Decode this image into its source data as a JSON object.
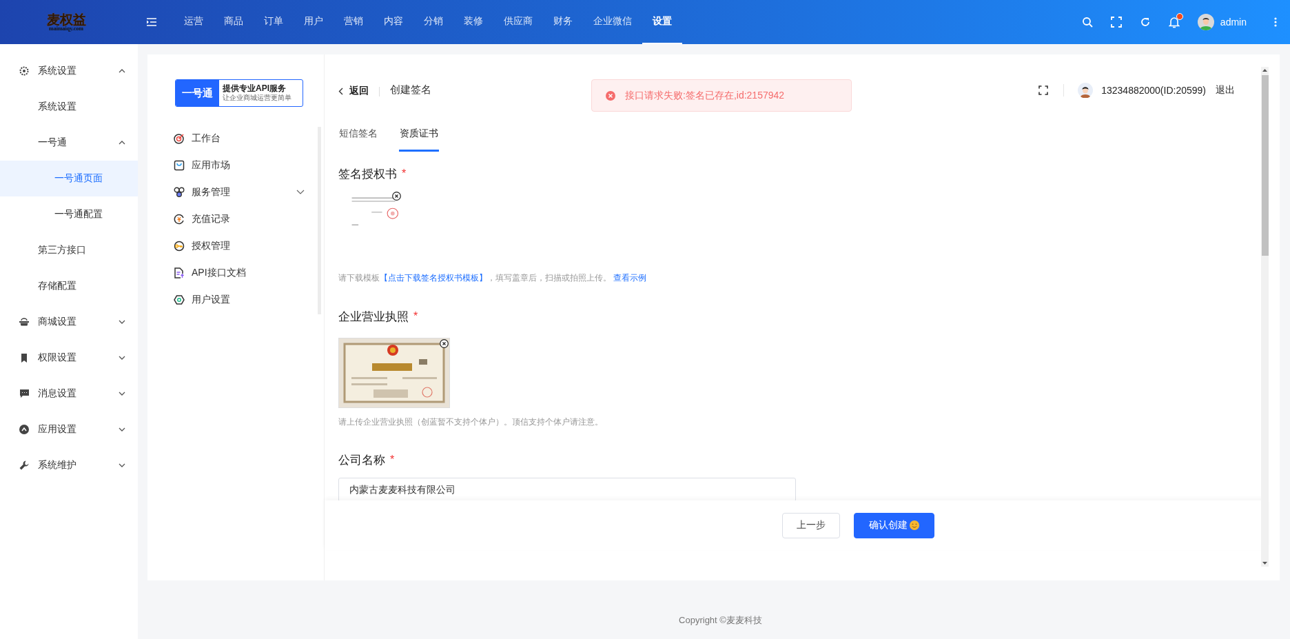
{
  "logo": {
    "name": "麦权益",
    "domain": "maimaiqy.com"
  },
  "top_nav": [
    {
      "label": "运营",
      "selected": false
    },
    {
      "label": "商品",
      "selected": false
    },
    {
      "label": "订单",
      "selected": false
    },
    {
      "label": "用户",
      "selected": false
    },
    {
      "label": "营销",
      "selected": false
    },
    {
      "label": "内容",
      "selected": false
    },
    {
      "label": "分销",
      "selected": false
    },
    {
      "label": "装修",
      "selected": false
    },
    {
      "label": "供应商",
      "selected": false
    },
    {
      "label": "财务",
      "selected": false
    },
    {
      "label": "企业微信",
      "selected": false
    },
    {
      "label": "设置",
      "selected": true
    }
  ],
  "user": {
    "name": "admin",
    "has_notification": true
  },
  "sidebar": [
    {
      "label": "系统设置",
      "expanded": true,
      "children": [
        {
          "label": "系统设置",
          "selected": false
        },
        {
          "label": "一号通",
          "expanded": true,
          "children": [
            {
              "label": "一号通页面",
              "selected": true
            },
            {
              "label": "一号通配置",
              "selected": false
            }
          ]
        },
        {
          "label": "第三方接口",
          "selected": false
        },
        {
          "label": "存储配置",
          "selected": false
        }
      ]
    },
    {
      "label": "商城设置",
      "expanded": false
    },
    {
      "label": "权限设置",
      "expanded": false
    },
    {
      "label": "消息设置",
      "expanded": false
    },
    {
      "label": "应用设置",
      "expanded": false
    },
    {
      "label": "系统维护",
      "expanded": false
    }
  ],
  "service_badge": {
    "brand": "一号通",
    "title": "提供专业API服务",
    "subtitle": "让企业商城运营更简单"
  },
  "service_menu": [
    {
      "label": "工作台"
    },
    {
      "label": "应用市场"
    },
    {
      "label": "服务管理",
      "expanded": false
    },
    {
      "label": "充值记录"
    },
    {
      "label": "授权管理"
    },
    {
      "label": "API接口文档"
    },
    {
      "label": "用户设置"
    }
  ],
  "header": {
    "back": "返回",
    "title": "创建签名",
    "account": "13234882000(ID:20599)",
    "logout": "退出"
  },
  "toast": {
    "kind": "error",
    "message": "接口请求失败:签名已存在,id:2157942"
  },
  "tabs": [
    {
      "label": "短信签名",
      "selected": false
    },
    {
      "label": "资质证书",
      "selected": true
    }
  ],
  "form": [
    {
      "kind": "upload",
      "label": "签名授权书",
      "required": "*",
      "image": {
        "kind": "picture"
      },
      "hint": [
        {
          "text": "请下载模板",
          "link": false
        },
        {
          "text": "【点击下载签名授权书模板】",
          "link": true
        },
        {
          "text": "，填写盖章后，扫描或拍照上传。 ",
          "link": false
        },
        {
          "text": "查看示例",
          "link": true
        }
      ]
    },
    {
      "kind": "upload",
      "label": "企业营业执照",
      "required": "*",
      "image": {
        "kind": "picture"
      },
      "hint": [
        {
          "text": "请上传企业营业执照（创蓝暂不支持个体户）。顶信支持个体户请注意。",
          "link": false
        }
      ]
    },
    {
      "kind": "input",
      "label": "公司名称",
      "required": "*",
      "value": "内蒙古麦麦科技有限公司"
    }
  ],
  "buttons": [
    {
      "label": "上一步",
      "kind": "secondary"
    },
    {
      "label": "确认创建",
      "kind": "primary",
      "emoji": true
    }
  ],
  "footer": "Copyright ©麦麦科技"
}
